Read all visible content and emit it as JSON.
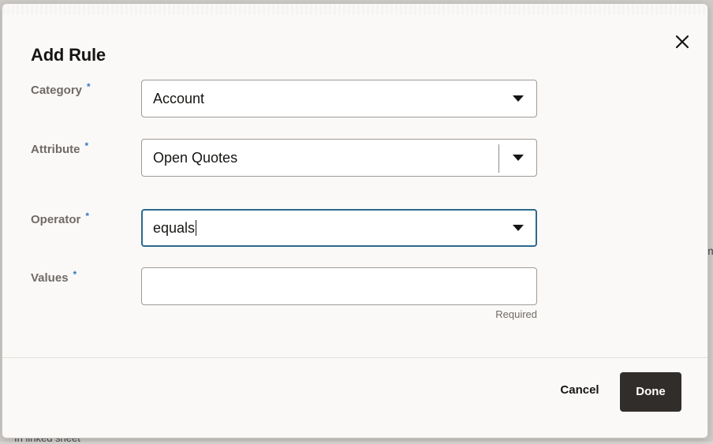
{
  "background": {
    "partial_text_bottom": "In linked sheet",
    "partial_text_edge": "m"
  },
  "dialog": {
    "title": "Add Rule",
    "close_icon": "close-icon"
  },
  "fields": {
    "category": {
      "label": "Category",
      "required_marker": "*",
      "value": "Account"
    },
    "attribute": {
      "label": "Attribute",
      "required_marker": "*",
      "value": "Open Quotes"
    },
    "operator": {
      "label": "Operator",
      "required_marker": "*",
      "value": "equals"
    },
    "values": {
      "label": "Values",
      "required_marker": "*",
      "value": "",
      "helper": "Required"
    }
  },
  "footer": {
    "cancel_label": "Cancel",
    "done_label": "Done"
  },
  "colors": {
    "primary_button": "#312d2a",
    "focus_border": "#2b6a8c",
    "required_star": "#2f7bbf",
    "label_text": "#6f6b66"
  }
}
